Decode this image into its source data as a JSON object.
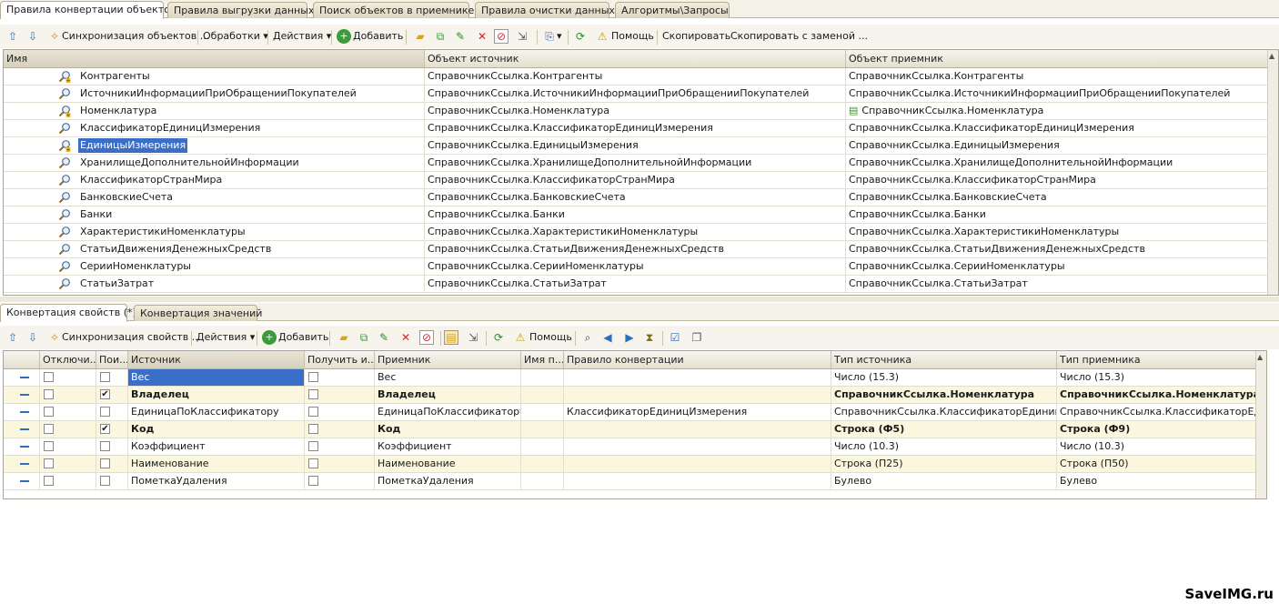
{
  "top_tabs": [
    {
      "label": "Правила конвертации объектов",
      "active": true
    },
    {
      "label": "Правила выгрузки данных",
      "active": false
    },
    {
      "label": "Поиск объектов в приемнике",
      "active": false
    },
    {
      "label": "Правила очистки данных",
      "active": false
    },
    {
      "label": "Алгоритмы\\Запросы",
      "active": false
    }
  ],
  "toolbar1": {
    "sync": "Синхронизация объектов ...",
    "processing": "Обработки",
    "actions": "Действия",
    "add": "Добавить",
    "help": "Помощь",
    "copy": "Скопировать",
    "copy_replace": "Скопировать с заменой ..."
  },
  "grid1": {
    "headers": [
      "Имя",
      "Объект источник",
      "Объект приемник"
    ],
    "rows": [
      {
        "name": "Контрагенты",
        "source": "СправочникСсылка.Контрагенты",
        "target": "СправочникСсылка.Контрагенты",
        "mark": "plus"
      },
      {
        "name": "ИсточникиИнформацииПриОбращенииПокупателей",
        "source": "СправочникСсылка.ИсточникиИнформацииПриОбращенииПокупателей",
        "target": "СправочникСсылка.ИсточникиИнформацииПриОбращенииПокупателей",
        "mark": ""
      },
      {
        "name": "Номенклатура",
        "source": "СправочникСсылка.Номенклатура",
        "target": "СправочникСсылка.Номенклатура",
        "mark": "plus",
        "target_icon": true
      },
      {
        "name": "КлассификаторЕдиницИзмерения",
        "source": "СправочникСсылка.КлассификаторЕдиницИзмерения",
        "target": "СправочникСсылка.КлассификаторЕдиницИзмерения",
        "mark": ""
      },
      {
        "name": "ЕдиницыИзмерения",
        "source": "СправочникСсылка.ЕдиницыИзмерения",
        "target": "СправочникСсылка.ЕдиницыИзмерения",
        "mark": "plus",
        "selected": true
      },
      {
        "name": "ХранилищеДополнительнойИнформации",
        "source": "СправочникСсылка.ХранилищеДополнительнойИнформации",
        "target": "СправочникСсылка.ХранилищеДополнительнойИнформации",
        "mark": ""
      },
      {
        "name": "КлассификаторСтранМира",
        "source": "СправочникСсылка.КлассификаторСтранМира",
        "target": "СправочникСсылка.КлассификаторСтранМира",
        "mark": ""
      },
      {
        "name": "БанковскиеСчета",
        "source": "СправочникСсылка.БанковскиеСчета",
        "target": "СправочникСсылка.БанковскиеСчета",
        "mark": ""
      },
      {
        "name": "Банки",
        "source": "СправочникСсылка.Банки",
        "target": "СправочникСсылка.Банки",
        "mark": ""
      },
      {
        "name": "ХарактеристикиНоменклатуры",
        "source": "СправочникСсылка.ХарактеристикиНоменклатуры",
        "target": "СправочникСсылка.ХарактеристикиНоменклатуры",
        "mark": ""
      },
      {
        "name": "СтатьиДвиженияДенежныхСредств",
        "source": "СправочникСсылка.СтатьиДвиженияДенежныхСредств",
        "target": "СправочникСсылка.СтатьиДвиженияДенежныхСредств",
        "mark": ""
      },
      {
        "name": "СерииНоменклатуры",
        "source": "СправочникСсылка.СерииНоменклатуры",
        "target": "СправочникСсылка.СерииНоменклатуры",
        "mark": ""
      },
      {
        "name": "СтатьиЗатрат",
        "source": "СправочникСсылка.СтатьиЗатрат",
        "target": "СправочникСсылка.СтатьиЗатрат",
        "mark": ""
      }
    ]
  },
  "bottom_tabs": [
    {
      "label": "Конвертация свойств (*)",
      "active": true
    },
    {
      "label": "Конвертация значений",
      "active": false
    }
  ],
  "toolbar2": {
    "sync": "Синхронизация свойств ...",
    "actions": "Действия",
    "add": "Добавить",
    "help": "Помощь"
  },
  "grid2": {
    "headers": [
      "",
      "Отключи...",
      "Пои...",
      "Источник",
      "Получить и...",
      "Приемник",
      "Имя п...",
      "Правило конвертации",
      "Тип источника",
      "Тип приемника"
    ],
    "rows": [
      {
        "disabled": false,
        "search": false,
        "source": "Вес",
        "get": false,
        "target": "Вес",
        "rule": "",
        "src_type": "Число (15.3)",
        "dst_type": "Число (15.3)",
        "bold": false,
        "highlight": false,
        "selected_source": true
      },
      {
        "disabled": false,
        "search": true,
        "source": "Владелец",
        "get": false,
        "target": "Владелец",
        "rule": "",
        "src_type": "СправочникСсылка.Номенклатура",
        "dst_type": "СправочникСсылка.Номенклатура,...",
        "bold": true,
        "highlight": true
      },
      {
        "disabled": false,
        "search": false,
        "source": "ЕдиницаПоКлассификатору",
        "get": false,
        "target": "ЕдиницаПоКлассификатору",
        "rule": "КлассификаторЕдиницИзмерения",
        "src_type": "СправочникСсылка.КлассификаторЕдиницИ...",
        "dst_type": "СправочникСсылка.КлассификаторЕдини...",
        "bold": false,
        "highlight": false
      },
      {
        "disabled": false,
        "search": true,
        "source": "Код",
        "get": false,
        "target": "Код",
        "rule": "",
        "src_type": "Строка (Ф5)",
        "dst_type": "Строка (Ф9)",
        "bold": true,
        "highlight": true
      },
      {
        "disabled": false,
        "search": false,
        "source": "Коэффициент",
        "get": false,
        "target": "Коэффициент",
        "rule": "",
        "src_type": "Число (10.3)",
        "dst_type": "Число (10.3)",
        "bold": false,
        "highlight": false
      },
      {
        "disabled": false,
        "search": false,
        "source": "Наименование",
        "get": false,
        "target": "Наименование",
        "rule": "",
        "src_type": "Строка (П25)",
        "dst_type": "Строка (П50)",
        "bold": false,
        "highlight": true
      },
      {
        "disabled": false,
        "search": false,
        "source": "ПометкаУдаления",
        "get": false,
        "target": "ПометкаУдаления",
        "rule": "",
        "src_type": "Булево",
        "dst_type": "Булево",
        "bold": false,
        "highlight": false
      }
    ]
  },
  "watermark": "SaveIMG.ru",
  "colors": {
    "selected": "#3a6fc9",
    "highlight": "#fbf6de",
    "accent": "#2f6dbd"
  }
}
